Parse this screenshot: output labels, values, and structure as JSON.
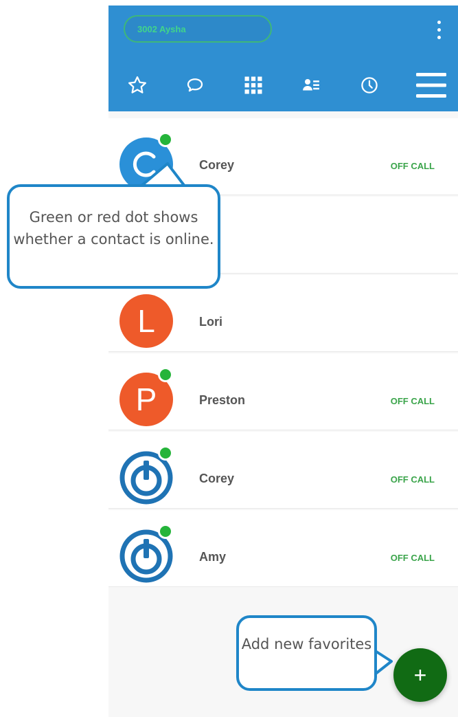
{
  "header": {
    "extension_label": "3002 Aysha",
    "tabs": [
      {
        "icon": "star-icon"
      },
      {
        "icon": "chat-icon"
      },
      {
        "icon": "dialpad-icon"
      },
      {
        "icon": "contacts-icon"
      },
      {
        "icon": "clock-icon"
      },
      {
        "icon": "menu-icon"
      }
    ]
  },
  "contacts": [
    {
      "name": "Corey",
      "avatar": "C",
      "avatar_color": "#2a90d8",
      "online": true,
      "status": "OFF CALL"
    },
    {
      "name": "",
      "avatar": "",
      "online": false,
      "status": ""
    },
    {
      "name": "Lori",
      "avatar": "L",
      "avatar_color": "#ee5a2a",
      "online": false,
      "status": ""
    },
    {
      "name": "Preston",
      "avatar": "P",
      "avatar_color": "#ee5a2a",
      "online": true,
      "status": "OFF CALL"
    },
    {
      "name": "Corey",
      "avatar": "logo",
      "online": true,
      "status": "OFF CALL"
    },
    {
      "name": "Amy",
      "avatar": "logo",
      "online": true,
      "status": "OFF CALL"
    }
  ],
  "callouts": {
    "online_dot": "Green or red dot shows whether a contact is online.",
    "add_favorites": "Add new favorites"
  },
  "fab": {
    "label": "+"
  },
  "colors": {
    "header": "#2f8fd2",
    "online": "#25b43a",
    "fab": "#116b14",
    "callout_border": "#1f86c8"
  }
}
